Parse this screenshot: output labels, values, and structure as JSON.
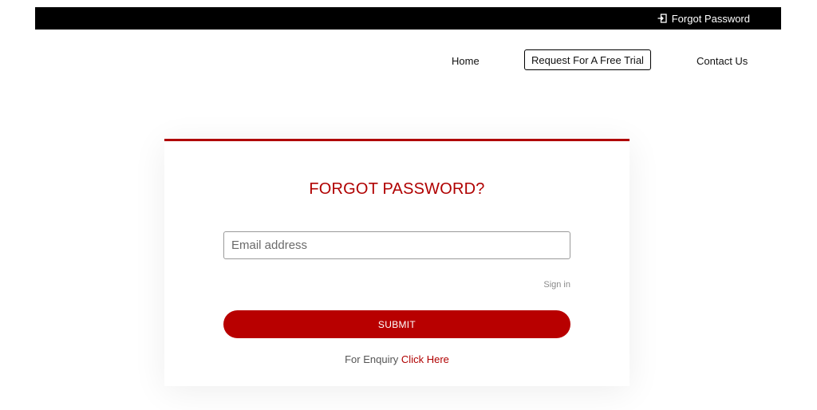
{
  "topbar": {
    "link_label": "Forgot Password",
    "link_icon": "sign-in-icon"
  },
  "nav": {
    "home": "Home",
    "trial": "Request For A Free Trial",
    "contact": "Contact Us"
  },
  "form": {
    "title": "FORGOT PASSWORD?",
    "email_value": "",
    "email_placeholder": "Email address",
    "signin_label": "Sign in",
    "submit_label": "SUBMIT",
    "enquiry_text": "For Enquiry",
    "enquiry_link": "Click Here"
  },
  "colors": {
    "accent": "#b80000",
    "topbar": "#000000"
  }
}
